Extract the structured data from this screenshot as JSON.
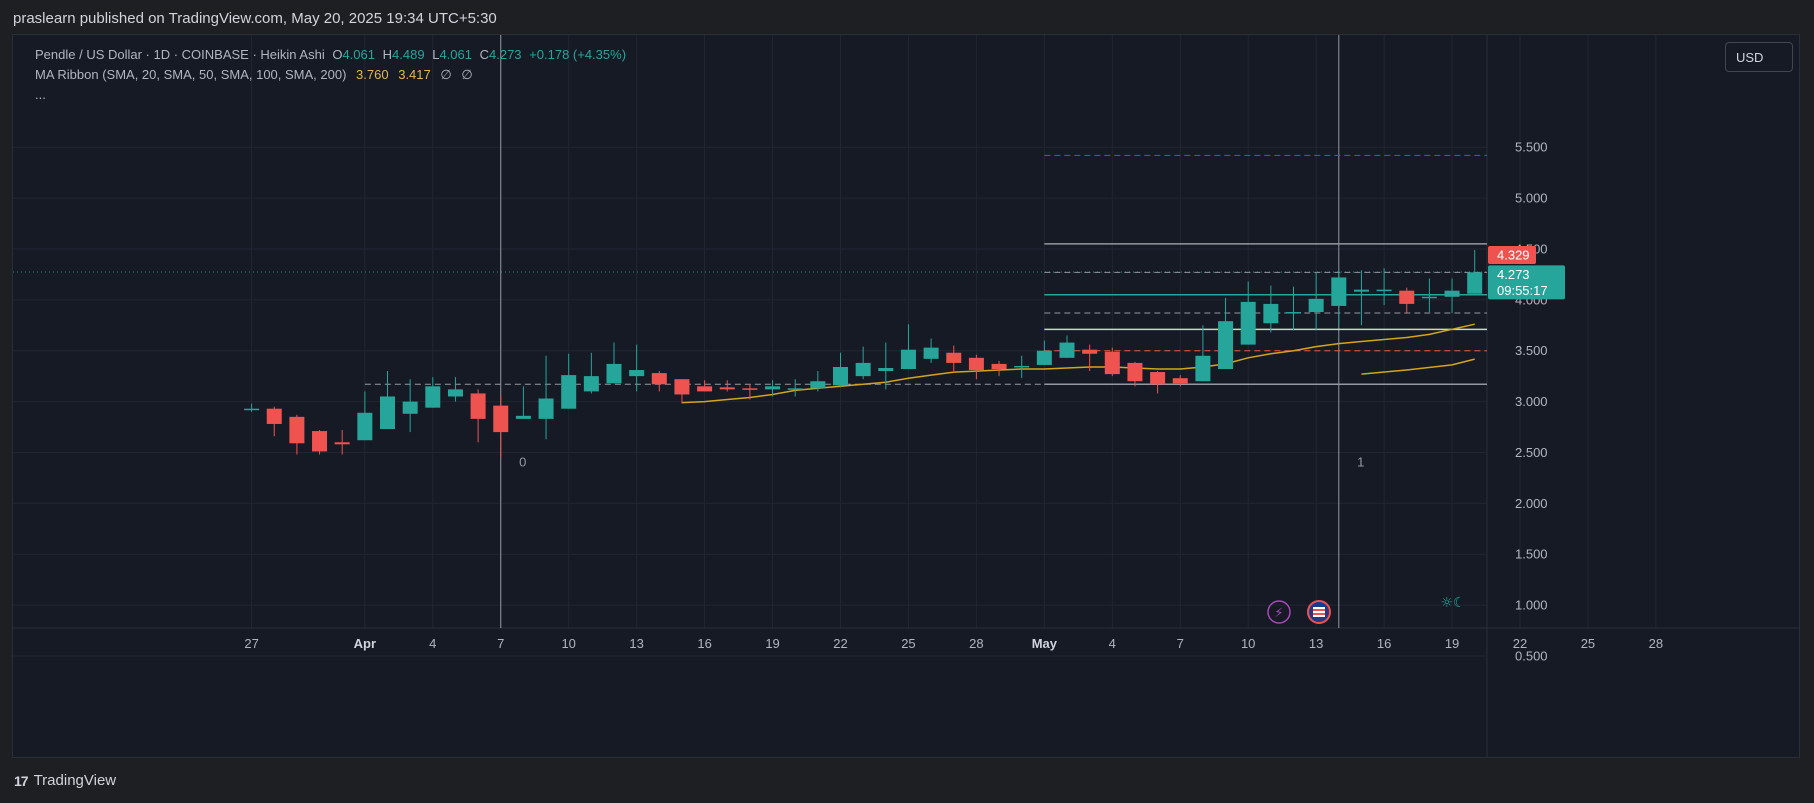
{
  "header": {
    "published": "praslearn published on TradingView.com, May 20, 2025 19:34 UTC+5:30"
  },
  "legend": {
    "symbol": "Pendle / US Dollar · 1D · COINBASE · Heikin Ashi",
    "o_label": "O",
    "o_value": "4.061",
    "h_label": "H",
    "h_value": "4.489",
    "l_label": "L",
    "l_value": "4.061",
    "c_label": "C",
    "c_value": "4.273",
    "change": "+0.178 (+4.35%)",
    "ma_title": "MA Ribbon (SMA, 20, SMA, 50, SMA, 100, SMA, 200)",
    "ma_v1": "3.760",
    "ma_v2": "3.417",
    "ma_v3": "∅",
    "ma_v4": "∅",
    "more": "..."
  },
  "currency_button": "USD",
  "footer": {
    "brand": "TradingView",
    "logo_mark": "17"
  },
  "colors": {
    "up": "#26a69a",
    "down": "#ef5350",
    "ma20": "#d4a51a",
    "ma50": "#d4a51a",
    "grid": "#232632",
    "text": "#b2b5be"
  },
  "chart_data": {
    "type": "candlestick",
    "style": "Heikin Ashi",
    "interval": "1D",
    "yticks": [
      "5.500",
      "5.000",
      "4.500",
      "4.000",
      "3.500",
      "3.000",
      "2.500",
      "2.000",
      "1.500",
      "1.000",
      "0.500"
    ],
    "ytick_values": [
      5.5,
      5.0,
      4.5,
      4.0,
      3.5,
      3.0,
      2.5,
      2.0,
      1.5,
      1.0,
      0.5
    ],
    "xticks": [
      "27",
      "Apr",
      "4",
      "7",
      "10",
      "13",
      "16",
      "19",
      "22",
      "25",
      "28",
      "May",
      "4",
      "7",
      "10",
      "13",
      "16",
      "19",
      "22",
      "25",
      "28"
    ],
    "xtick_days": [
      -4,
      1,
      4,
      7,
      10,
      13,
      16,
      19,
      22,
      25,
      28,
      31,
      34,
      37,
      40,
      43,
      46,
      49,
      52,
      55,
      58
    ],
    "ylim": [
      0.3,
      5.83
    ],
    "candles": [
      {
        "d": -4,
        "o": 2.93,
        "h": 2.98,
        "l": 2.9,
        "c": 2.93
      },
      {
        "d": -3,
        "o": 2.93,
        "h": 2.95,
        "l": 2.66,
        "c": 2.78
      },
      {
        "d": -2,
        "o": 2.85,
        "h": 2.87,
        "l": 2.48,
        "c": 2.59
      },
      {
        "d": -1,
        "o": 2.71,
        "h": 2.72,
        "l": 2.48,
        "c": 2.51
      },
      {
        "d": 0,
        "o": 2.6,
        "h": 2.72,
        "l": 2.48,
        "c": 2.58
      },
      {
        "d": 1,
        "o": 2.62,
        "h": 3.1,
        "l": 2.62,
        "c": 2.89
      },
      {
        "d": 2,
        "o": 2.73,
        "h": 3.3,
        "l": 2.73,
        "c": 3.05
      },
      {
        "d": 3,
        "o": 2.88,
        "h": 3.22,
        "l": 2.7,
        "c": 3.0
      },
      {
        "d": 4,
        "o": 2.94,
        "h": 3.24,
        "l": 2.94,
        "c": 3.15
      },
      {
        "d": 5,
        "o": 3.05,
        "h": 3.24,
        "l": 3.0,
        "c": 3.12
      },
      {
        "d": 6,
        "o": 3.08,
        "h": 3.12,
        "l": 2.6,
        "c": 2.83
      },
      {
        "d": 7,
        "o": 2.96,
        "h": 3.06,
        "l": 2.45,
        "c": 2.7
      },
      {
        "d": 8,
        "o": 2.83,
        "h": 3.15,
        "l": 2.83,
        "c": 2.86
      },
      {
        "d": 9,
        "o": 2.83,
        "h": 3.45,
        "l": 2.63,
        "c": 3.03
      },
      {
        "d": 10,
        "o": 2.93,
        "h": 3.47,
        "l": 2.93,
        "c": 3.26
      },
      {
        "d": 11,
        "o": 3.1,
        "h": 3.48,
        "l": 3.08,
        "c": 3.25
      },
      {
        "d": 12,
        "o": 3.18,
        "h": 3.58,
        "l": 3.18,
        "c": 3.37
      },
      {
        "d": 13,
        "o": 3.25,
        "h": 3.56,
        "l": 3.1,
        "c": 3.31
      },
      {
        "d": 14,
        "o": 3.28,
        "h": 3.3,
        "l": 3.1,
        "c": 3.17
      },
      {
        "d": 15,
        "o": 3.22,
        "h": 3.22,
        "l": 2.98,
        "c": 3.07
      },
      {
        "d": 16,
        "o": 3.15,
        "h": 3.21,
        "l": 3.1,
        "c": 3.1
      },
      {
        "d": 17,
        "o": 3.14,
        "h": 3.21,
        "l": 3.1,
        "c": 3.12
      },
      {
        "d": 18,
        "o": 3.13,
        "h": 3.17,
        "l": 3.02,
        "c": 3.12
      },
      {
        "d": 19,
        "o": 3.12,
        "h": 3.21,
        "l": 3.05,
        "c": 3.15
      },
      {
        "d": 20,
        "o": 3.12,
        "h": 3.22,
        "l": 3.05,
        "c": 3.13
      },
      {
        "d": 21,
        "o": 3.13,
        "h": 3.3,
        "l": 3.1,
        "c": 3.2
      },
      {
        "d": 22,
        "o": 3.16,
        "h": 3.48,
        "l": 3.14,
        "c": 3.34
      },
      {
        "d": 23,
        "o": 3.25,
        "h": 3.54,
        "l": 3.22,
        "c": 3.38
      },
      {
        "d": 24,
        "o": 3.3,
        "h": 3.58,
        "l": 3.12,
        "c": 3.33
      },
      {
        "d": 25,
        "o": 3.32,
        "h": 3.76,
        "l": 3.32,
        "c": 3.51
      },
      {
        "d": 26,
        "o": 3.42,
        "h": 3.62,
        "l": 3.38,
        "c": 3.53
      },
      {
        "d": 27,
        "o": 3.48,
        "h": 3.55,
        "l": 3.3,
        "c": 3.38
      },
      {
        "d": 28,
        "o": 3.43,
        "h": 3.46,
        "l": 3.22,
        "c": 3.31
      },
      {
        "d": 29,
        "o": 3.37,
        "h": 3.4,
        "l": 3.25,
        "c": 3.32
      },
      {
        "d": 30,
        "o": 3.35,
        "h": 3.45,
        "l": 3.23,
        "c": 3.35
      },
      {
        "d": 31,
        "o": 3.36,
        "h": 3.6,
        "l": 3.36,
        "c": 3.5
      },
      {
        "d": 32,
        "o": 3.43,
        "h": 3.65,
        "l": 3.43,
        "c": 3.58
      },
      {
        "d": 33,
        "o": 3.51,
        "h": 3.56,
        "l": 3.3,
        "c": 3.47
      },
      {
        "d": 34,
        "o": 3.49,
        "h": 3.53,
        "l": 3.25,
        "c": 3.27
      },
      {
        "d": 35,
        "o": 3.38,
        "h": 3.39,
        "l": 3.15,
        "c": 3.2
      },
      {
        "d": 36,
        "o": 3.29,
        "h": 3.3,
        "l": 3.08,
        "c": 3.17
      },
      {
        "d": 37,
        "o": 3.23,
        "h": 3.26,
        "l": 3.15,
        "c": 3.18
      },
      {
        "d": 38,
        "o": 3.2,
        "h": 3.75,
        "l": 3.2,
        "c": 3.45
      },
      {
        "d": 39,
        "o": 3.32,
        "h": 4.02,
        "l": 3.32,
        "c": 3.79
      },
      {
        "d": 40,
        "o": 3.56,
        "h": 4.18,
        "l": 3.56,
        "c": 3.98
      },
      {
        "d": 41,
        "o": 3.77,
        "h": 4.14,
        "l": 3.68,
        "c": 3.96
      },
      {
        "d": 42,
        "o": 3.88,
        "h": 4.13,
        "l": 3.7,
        "c": 3.88
      },
      {
        "d": 43,
        "o": 3.88,
        "h": 4.27,
        "l": 3.7,
        "c": 4.01
      },
      {
        "d": 44,
        "o": 3.94,
        "h": 4.3,
        "l": 3.74,
        "c": 4.22
      },
      {
        "d": 45,
        "o": 4.08,
        "h": 4.29,
        "l": 3.75,
        "c": 4.1
      },
      {
        "d": 46,
        "o": 4.09,
        "h": 4.31,
        "l": 3.95,
        "c": 4.1
      },
      {
        "d": 47,
        "o": 4.09,
        "h": 4.12,
        "l": 3.87,
        "c": 3.96
      },
      {
        "d": 48,
        "o": 4.03,
        "h": 4.21,
        "l": 3.88,
        "c": 4.03
      },
      {
        "d": 49,
        "o": 4.03,
        "h": 4.21,
        "l": 3.87,
        "c": 4.09
      },
      {
        "d": 50,
        "o": 4.06,
        "h": 4.49,
        "l": 4.06,
        "c": 4.27
      }
    ],
    "ma20": [
      [
        15,
        2.99
      ],
      [
        16,
        3.0
      ],
      [
        17,
        3.02
      ],
      [
        18,
        3.04
      ],
      [
        19,
        3.07
      ],
      [
        20,
        3.11
      ],
      [
        21,
        3.13
      ],
      [
        22,
        3.15
      ],
      [
        23,
        3.17
      ],
      [
        24,
        3.19
      ],
      [
        25,
        3.23
      ],
      [
        26,
        3.26
      ],
      [
        27,
        3.29
      ],
      [
        28,
        3.3
      ],
      [
        29,
        3.31
      ],
      [
        30,
        3.32
      ],
      [
        31,
        3.32
      ],
      [
        32,
        3.33
      ],
      [
        33,
        3.34
      ],
      [
        34,
        3.34
      ],
      [
        35,
        3.33
      ],
      [
        36,
        3.32
      ],
      [
        37,
        3.32
      ],
      [
        38,
        3.34
      ],
      [
        39,
        3.37
      ],
      [
        40,
        3.43
      ],
      [
        41,
        3.47
      ],
      [
        42,
        3.5
      ],
      [
        43,
        3.54
      ],
      [
        44,
        3.57
      ],
      [
        45,
        3.59
      ],
      [
        46,
        3.61
      ],
      [
        47,
        3.63
      ],
      [
        48,
        3.66
      ],
      [
        49,
        3.71
      ],
      [
        50,
        3.76
      ]
    ],
    "ma50": [
      [
        45,
        3.27
      ],
      [
        47,
        3.31
      ],
      [
        49,
        3.36
      ],
      [
        50,
        3.417
      ]
    ],
    "levels": [
      {
        "price": 5.42,
        "style": "dashed",
        "color": "#2962ff"
      },
      {
        "price": 4.55,
        "style": "solid",
        "color": "#9598a1"
      },
      {
        "price": 4.27,
        "style": "dashed",
        "color": "#9598a1"
      },
      {
        "price": 4.05,
        "style": "solid",
        "color": "#26a69a"
      },
      {
        "price": 3.87,
        "style": "dashed",
        "color": "#9598a1"
      },
      {
        "price": 3.71,
        "style": "solid",
        "color": "#c5e1a5"
      },
      {
        "price": 3.5,
        "style": "dashed",
        "color": "#ef5350"
      },
      {
        "price": 3.17,
        "style": "solid",
        "color": "#9598a1"
      }
    ],
    "earlier_levels": [
      {
        "price": 3.17,
        "style": "dashed",
        "color": "#9598a1",
        "from_day": 1,
        "to_day": 31
      }
    ],
    "vertical_markers": [
      {
        "day": 7,
        "label": "0"
      },
      {
        "day": 44,
        "label": "1"
      }
    ],
    "price_labels": [
      {
        "price": 4.44,
        "text": "4.329",
        "color": "#ef5350"
      },
      {
        "price": 4.25,
        "text": "4.273",
        "subtext": "09:55:17",
        "color": "#26a69a"
      }
    ],
    "current_price": 4.273
  }
}
